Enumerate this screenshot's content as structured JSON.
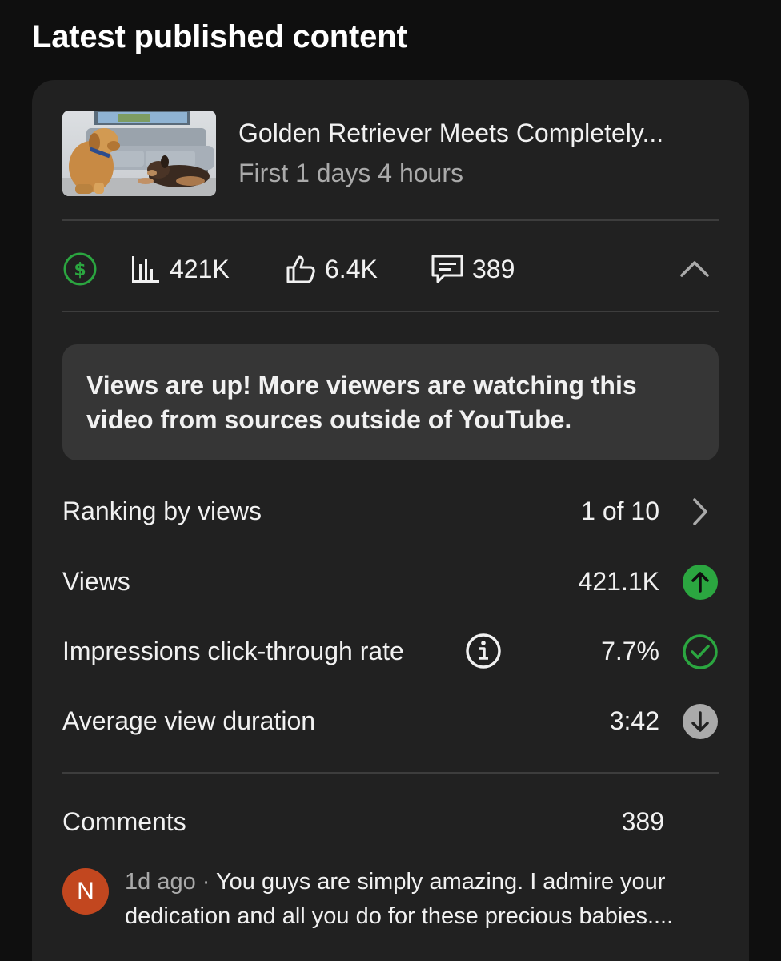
{
  "page": {
    "title": "Latest published content"
  },
  "video": {
    "title": "Golden Retriever Meets Completely...",
    "subtitle": "First 1 days 4 hours",
    "thumbnail_icon": "video-thumbnail"
  },
  "stats": {
    "monetization_icon": "dollar-circle-icon",
    "views": "421K",
    "likes": "6.4K",
    "comments": "389",
    "collapse_icon": "chevron-up-icon"
  },
  "insight": {
    "text": "Views are up! More viewers are watching this video from sources outside of YouTube."
  },
  "metrics": [
    {
      "label": "Ranking by views",
      "value": "1 of 10",
      "icon": "chevron-right-icon"
    },
    {
      "label": "Views",
      "value": "421.1K",
      "icon": "arrow-up-circle-icon",
      "status": "up"
    },
    {
      "label": "Impressions click-through rate",
      "value": "7.7%",
      "icon": "check-circle-icon",
      "status": "typical"
    },
    {
      "label": "Average view duration",
      "value": "3:42",
      "icon": "arrow-down-circle-icon",
      "status": "down"
    }
  ],
  "comments": {
    "label": "Comments",
    "count": "389",
    "latest": {
      "avatar_letter": "N",
      "time": "1d ago",
      "separator": " · ",
      "text": "You guys are simply amazing. I admire your dedication and all you do for these precious babies...."
    }
  },
  "colors": {
    "background": "#0f0f0f",
    "card": "#212121",
    "insight_box": "#363636",
    "accent_green": "#2ba640",
    "neutral_icon": "#aaaaaa",
    "avatar": "#c2471f"
  }
}
